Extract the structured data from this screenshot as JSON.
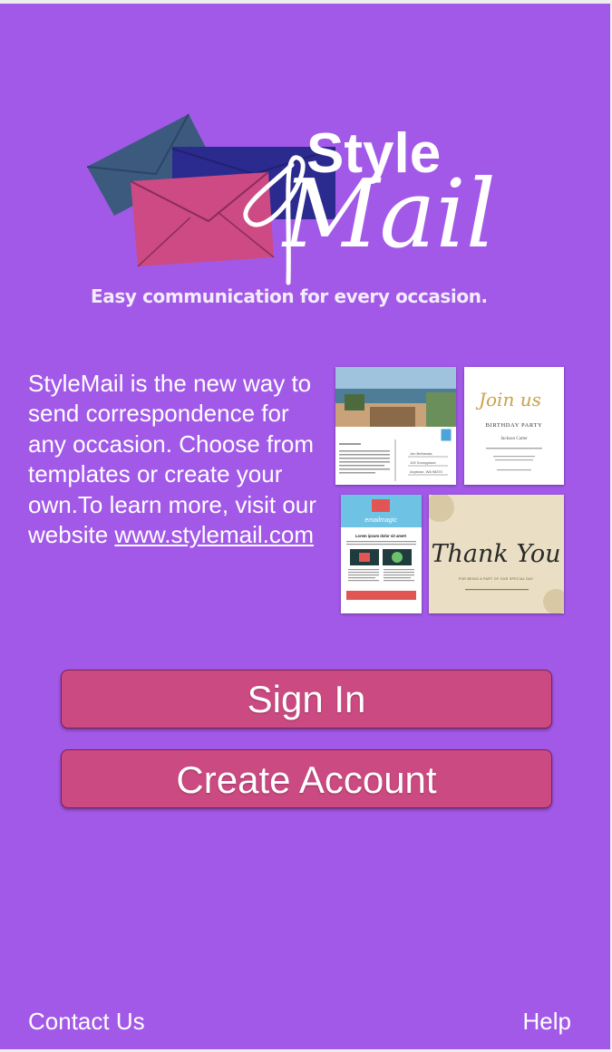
{
  "brand": {
    "logo_word_1": "Style",
    "logo_word_2": "Mail",
    "tagline": "Easy communication for every occasion."
  },
  "intro": {
    "text": "StyleMail is the new way to send correspondence for any occasion. Choose from templates or create your own.To learn more, visit our website ",
    "link_text": "www.stylemail.com"
  },
  "templates": {
    "postcard": {
      "address_lines": [
        "Jen Bethesda",
        "100 Sunnyplace",
        "Anytown, WA 98370"
      ]
    },
    "birthday": {
      "headline": "Join us",
      "line_1": "BIRTHDAY PARTY",
      "line_2": "Jackson Carter"
    },
    "newsletter": {
      "brand": "emailmagic",
      "heading": "Lorem ipsum dolor sit amet!"
    },
    "thank_you": {
      "headline": "Thank You",
      "subline": "FOR BEING A PART OF OUR SPECIAL DAY"
    }
  },
  "actions": {
    "sign_in": "Sign In",
    "create_account": "Create Account"
  },
  "footer": {
    "contact": "Contact Us",
    "help": "Help"
  },
  "colors": {
    "background": "#a259e8",
    "button": "#cc4a82",
    "envelope_teal": "#3c5a7e",
    "envelope_navy": "#2b2a8f",
    "envelope_pink": "#cd4a84"
  }
}
